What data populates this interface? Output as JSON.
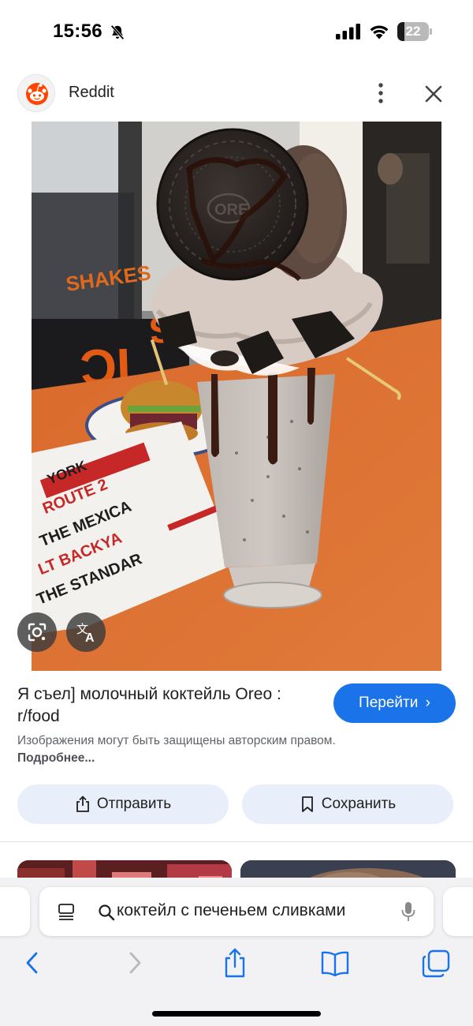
{
  "status_bar": {
    "time": "15:56",
    "battery_level": "22",
    "icons": [
      "bell-off-icon",
      "signal-icon",
      "wifi-icon",
      "battery-icon"
    ]
  },
  "source": {
    "name": "Reddit",
    "logo_icon": "reddit-logo-icon"
  },
  "result": {
    "title": "Я съел] молочный коктейль Oreo : r/food",
    "visit_label": "Перейти",
    "copyright_text": "Изображения могут быть защищены авторским правом.",
    "copyright_more": "Подробнее..."
  },
  "actions": {
    "share_label": "Отправить",
    "save_label": "Сохранить"
  },
  "browser": {
    "address_text": "коктейл с печеньем сливками"
  },
  "colors": {
    "accent": "#1a73e8",
    "chip_bg": "#e8eefa",
    "reddit": "#ff4500"
  }
}
